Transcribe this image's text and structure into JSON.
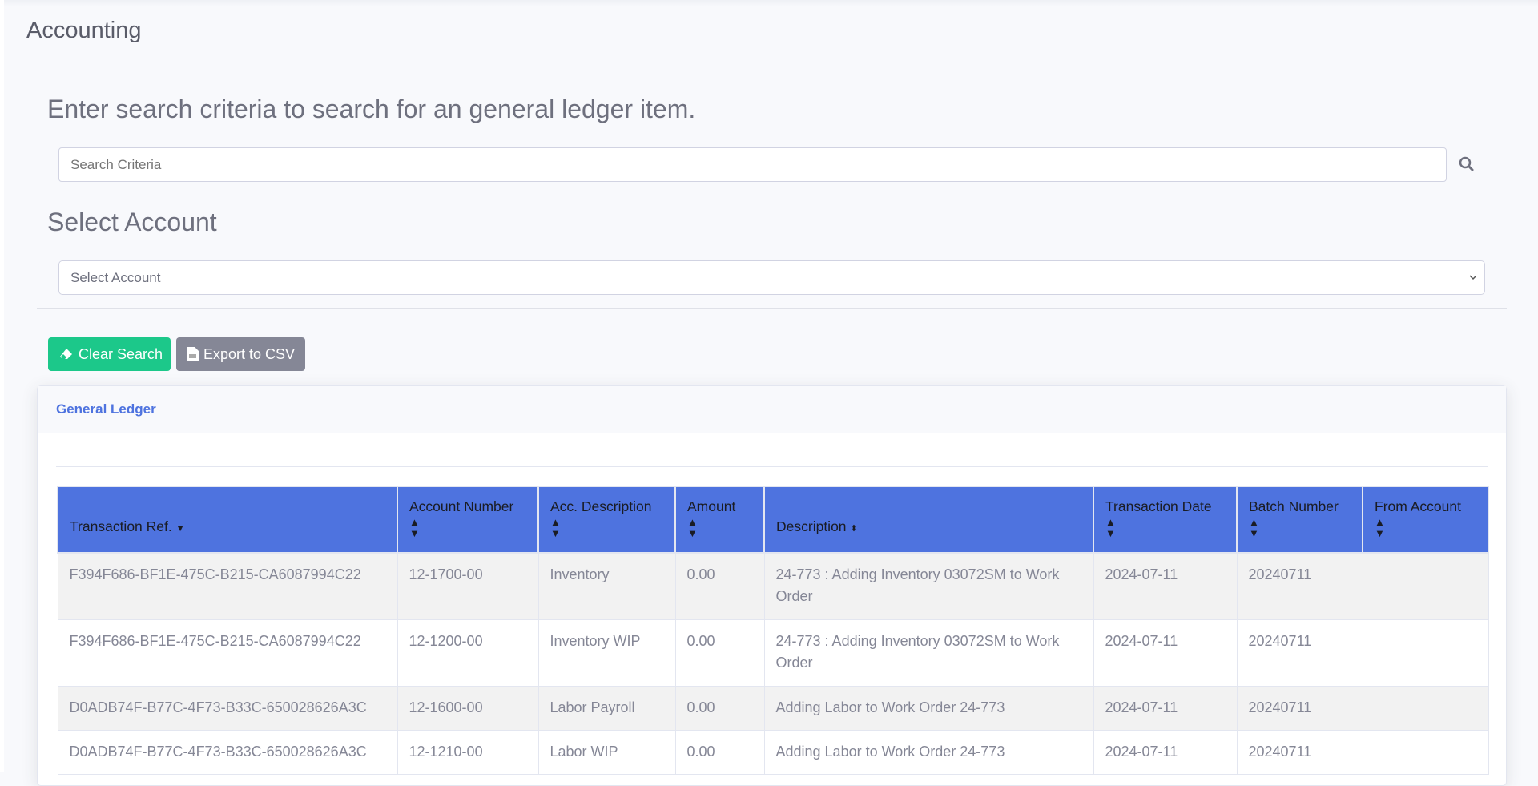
{
  "page_title": "Accounting",
  "search": {
    "heading": "Enter search criteria to search for an general ledger item.",
    "placeholder": "Search Criteria",
    "value": ""
  },
  "account": {
    "heading": "Select Account",
    "selected": "Select Account"
  },
  "buttons": {
    "clear": "Clear Search",
    "export": "Export to CSV"
  },
  "colors": {
    "primary": "#4e73df",
    "success": "#1cc88a",
    "secondary": "#858796"
  },
  "card": {
    "title": "General Ledger"
  },
  "table": {
    "columns": [
      "Transaction Ref.",
      "Account Number",
      "Acc. Description",
      "Amount",
      "Description",
      "Transaction Date",
      "Batch Number",
      "From Account"
    ],
    "rows": [
      [
        "F394F686-BF1E-475C-B215-CA6087994C22",
        "12-1700-00",
        "Inventory",
        "0.00",
        "24-773 : Adding Inventory 03072SM to Work Order",
        "2024-07-11",
        "20240711",
        ""
      ],
      [
        "F394F686-BF1E-475C-B215-CA6087994C22",
        "12-1200-00",
        "Inventory WIP",
        "0.00",
        "24-773 : Adding Inventory 03072SM to Work Order",
        "2024-07-11",
        "20240711",
        ""
      ],
      [
        "D0ADB74F-B77C-4F73-B33C-650028626A3C",
        "12-1600-00",
        "Labor Payroll",
        "0.00",
        "Adding Labor to Work Order 24-773",
        "2024-07-11",
        "20240711",
        ""
      ],
      [
        "D0ADB74F-B77C-4F73-B33C-650028626A3C",
        "12-1210-00",
        "Labor WIP",
        "0.00",
        "Adding Labor to Work Order 24-773",
        "2024-07-11",
        "20240711",
        ""
      ]
    ]
  }
}
